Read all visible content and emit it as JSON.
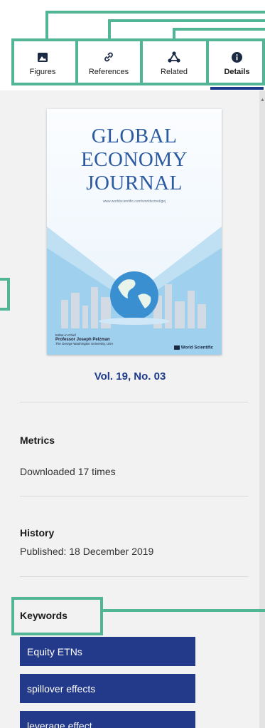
{
  "tabs": [
    {
      "label": "Figures",
      "icon": "image-icon",
      "active": false
    },
    {
      "label": "References",
      "icon": "link-icon",
      "active": false
    },
    {
      "label": "Related",
      "icon": "network-icon",
      "active": false
    },
    {
      "label": "Details",
      "icon": "info-icon",
      "active": true
    }
  ],
  "cover": {
    "title_lines": [
      "GLOBAL",
      "ECONOMY",
      "JOURNAL"
    ],
    "url": "www.worldscientific.com/worldscinet/gej",
    "editor_caption": "Editor-in-Chief",
    "editor_name": "Professor Joseph Pelzman",
    "editor_affiliation": "The George Washington University, USA",
    "publisher": "World Scientific"
  },
  "issue": "Vol. 19, No. 03",
  "metrics": {
    "heading": "Metrics",
    "downloads": "Downloaded 17 times"
  },
  "history": {
    "heading": "History",
    "published": "Published: 18 December 2019"
  },
  "keywords": {
    "heading": "Keywords",
    "items": [
      "Equity ETNs",
      "spillover effects",
      "leverage effect"
    ]
  },
  "colors": {
    "accent": "#233a8b",
    "annotation": "#52b596",
    "panel": "#f2f2f2"
  }
}
